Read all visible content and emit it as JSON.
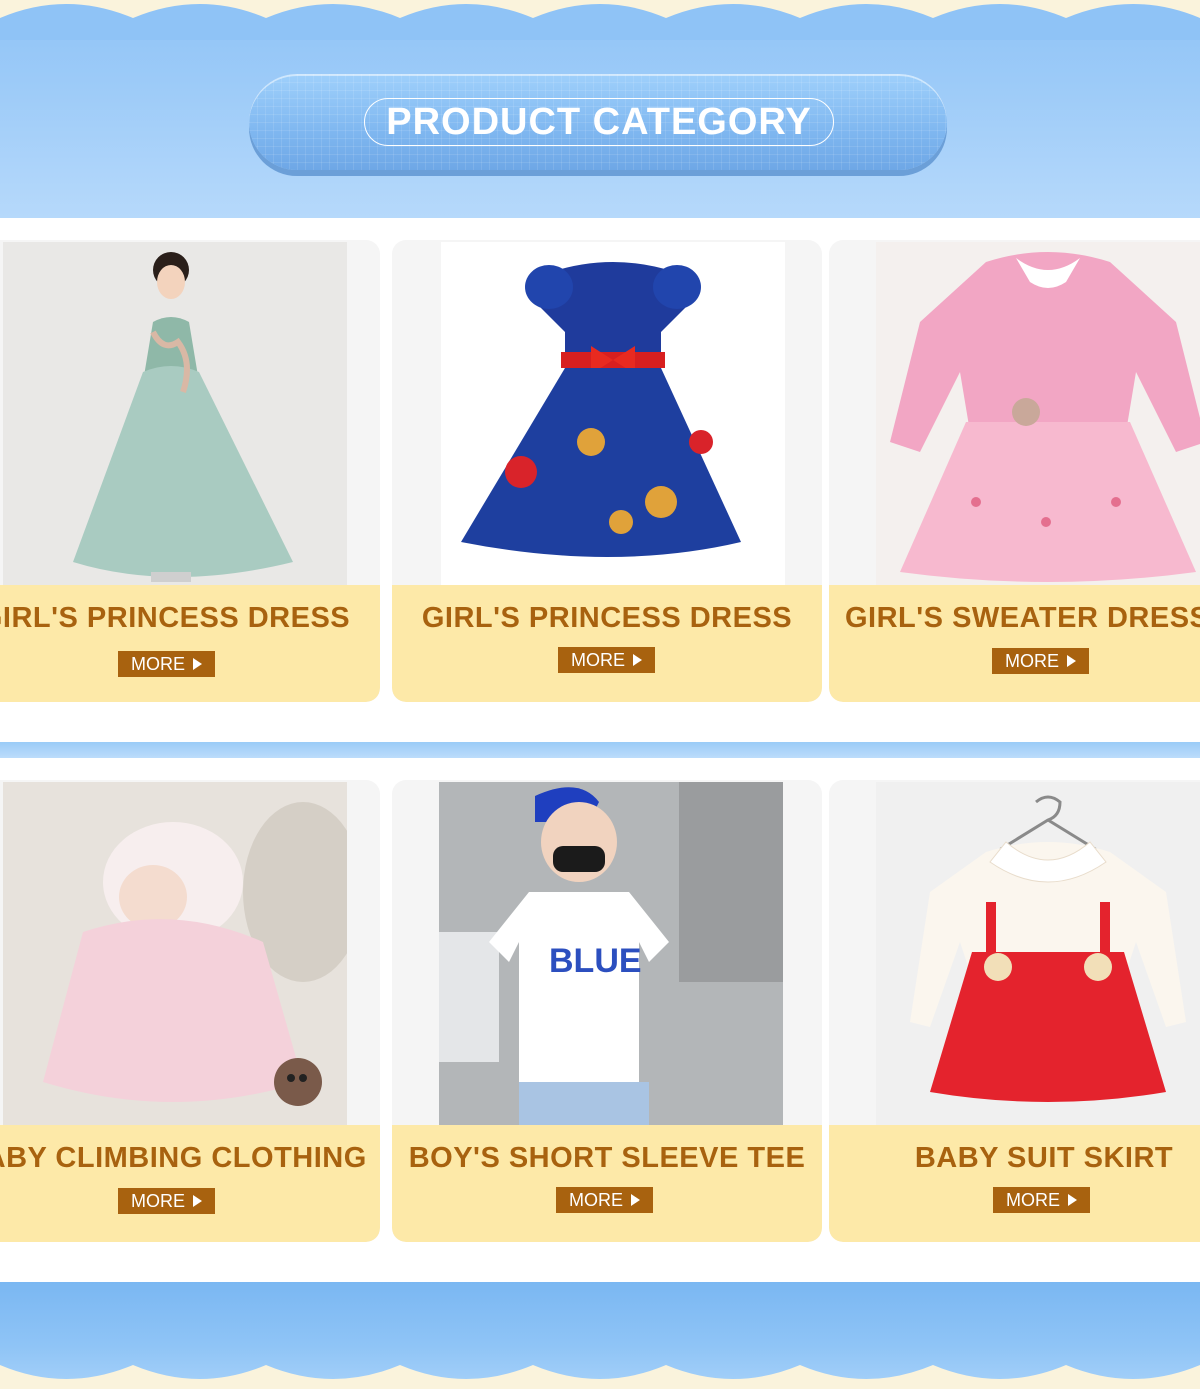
{
  "section": {
    "title": "PRODUCT CATEGORY"
  },
  "colors": {
    "header_blue": "#8fc3f6",
    "label_bg": "#fde9a8",
    "label_text": "#a8620f",
    "button_bg": "#a8620f",
    "cream": "#faf3dc"
  },
  "cards": [
    {
      "label": "GIRL'S PRINCESS DRESS",
      "button": "MORE",
      "button_icon": "play-triangle-icon",
      "image": "girl-princess-dress-photo"
    },
    {
      "label": "GIRL'S PRINCESS DRESS",
      "button": "MORE",
      "button_icon": "play-triangle-icon",
      "image": "blue-bear-print-dress-photo"
    },
    {
      "label": "GIRL'S SWEATER DRESS",
      "button": "MORE",
      "button_icon": "play-triangle-icon",
      "image": "pink-sweater-dress-photo"
    },
    {
      "label": "BABY CLIMBING CLOTHING",
      "button": "MORE",
      "button_icon": "play-triangle-icon",
      "image": "baby-romper-photo"
    },
    {
      "label": "BOY'S SHORT SLEEVE TEE",
      "button": "MORE",
      "button_icon": "play-triangle-icon",
      "image": "boy-tee-photo"
    },
    {
      "label": "BABY SUIT SKIRT",
      "button": "MORE",
      "button_icon": "play-triangle-icon",
      "image": "red-suit-skirt-photo"
    }
  ]
}
